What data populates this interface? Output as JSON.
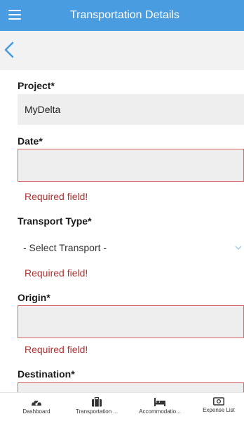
{
  "header": {
    "title": "Transportation Details",
    "menu_icon": "hamburger-menu-icon",
    "background": "#4a9ce0"
  },
  "subbar": {
    "back_icon": "chevron-left-icon"
  },
  "form": {
    "project": {
      "label": "Project*",
      "value": "MyDelta"
    },
    "date": {
      "label": "Date*",
      "value": "",
      "error": "Required field!"
    },
    "transport_type": {
      "label": "Transport Type*",
      "selected": "- Select Transport -",
      "error": "Required field!"
    },
    "origin": {
      "label": "Origin*",
      "value": "",
      "error": "Required field!"
    },
    "destination": {
      "label": "Destination*",
      "value": ""
    }
  },
  "bottom_nav": [
    {
      "label": "Dashboard",
      "icon": "dashboard-gauge-icon"
    },
    {
      "label": "Transportation ...",
      "icon": "briefcase-icon"
    },
    {
      "label": "Accommodatio...",
      "icon": "bed-icon"
    },
    {
      "label": "Expense List",
      "icon": "cash-icon"
    }
  ],
  "colors": {
    "error": "#b03030",
    "error_border": "#d96666",
    "accent": "#4a9ce0"
  }
}
